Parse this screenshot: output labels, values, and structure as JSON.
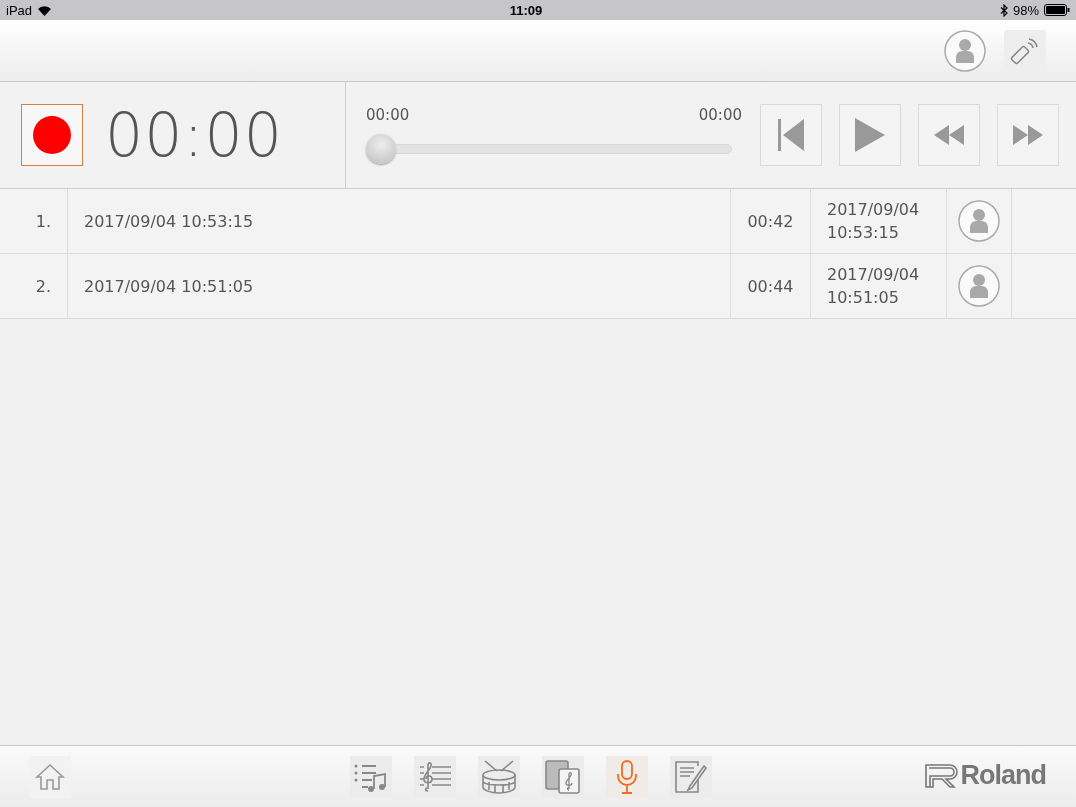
{
  "status_bar": {
    "device": "iPad",
    "time": "11:09",
    "battery": "98%"
  },
  "transport": {
    "record_time": "00:00",
    "position": "00:00",
    "length": "00:00",
    "level": 0,
    "recording": false
  },
  "recordings": [
    {
      "number": "1.",
      "title": "2017/09/04 10:53:15",
      "duration": "00:42",
      "date": "2017/09/04",
      "time": "10:53:15"
    },
    {
      "number": "2.",
      "title": "2017/09/04 10:51:05",
      "duration": "00:44",
      "date": "2017/09/04",
      "time": "10:51:05"
    }
  ],
  "tab_bar": {
    "tabs": [
      {
        "kind": "playlist",
        "selected": false
      },
      {
        "kind": "score",
        "selected": false
      },
      {
        "kind": "rhythm",
        "selected": false
      },
      {
        "kind": "flashcard",
        "selected": false
      },
      {
        "kind": "recorder",
        "selected": true
      },
      {
        "kind": "notes",
        "selected": false
      }
    ],
    "brand": "Roland"
  }
}
